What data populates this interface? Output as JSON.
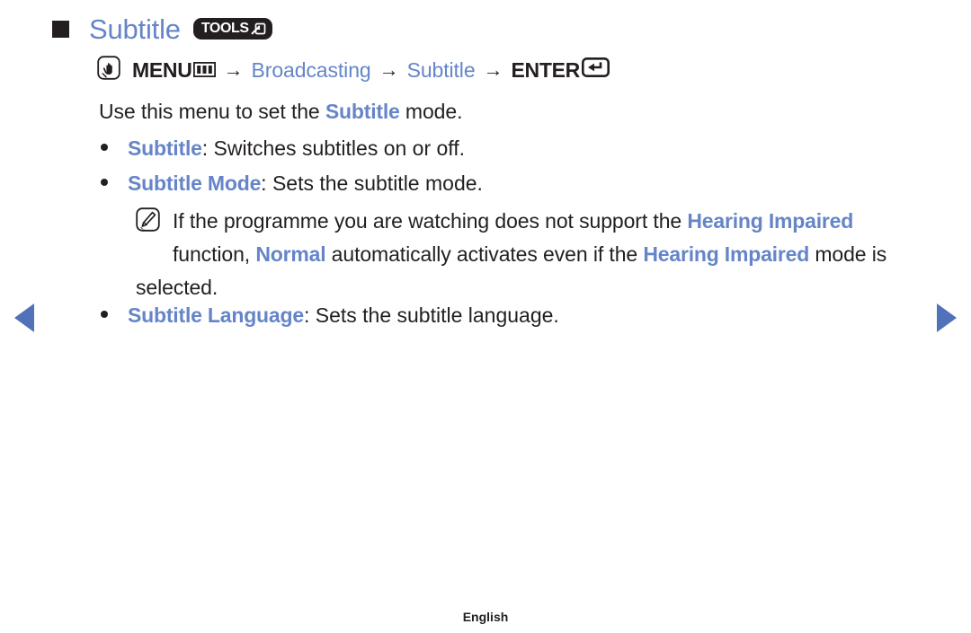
{
  "header": {
    "square_bullet": "square-bullet",
    "title": "Subtitle",
    "tools_badge": {
      "label": "TOOLS",
      "icon": "tools-arrow-icon"
    }
  },
  "menu_path": {
    "hand_icon": "hand-press-icon",
    "menu_label": "MENU",
    "menu_glyph": "menu-grid-icon",
    "arrow1": "→",
    "broadcasting_label": "Broadcasting",
    "arrow2": "→",
    "subtitle_label": "Subtitle",
    "arrow3": "→",
    "enter_label": "ENTER",
    "enter_glyph": "enter-key-icon"
  },
  "intro": {
    "before": "Use this menu to set the ",
    "highlight": "Subtitle",
    "after": " mode."
  },
  "bullets": [
    {
      "term": "Subtitle",
      "description": ": Switches subtitles on or off."
    },
    {
      "term": "Subtitle Mode",
      "description": ": Sets the subtitle mode."
    },
    {
      "term": "Subtitle Language",
      "description": ": Sets the subtitle language."
    }
  ],
  "note": {
    "icon": "note-pencil-icon",
    "part1": "If the programme you are watching does not support the ",
    "term1": "Hearing Impaired",
    "part2": " function, ",
    "term2": "Normal",
    "part3": " automatically activates even if the ",
    "term3": "Hearing Impaired",
    "part4": " mode is selected."
  },
  "navigation": {
    "prev": "previous-page-arrow",
    "next": "next-page-arrow"
  },
  "footer": {
    "language": "English"
  },
  "colors": {
    "accent_blue": "#6585c8",
    "arrow_blue": "#5172b8",
    "text_dark": "#231f20"
  }
}
